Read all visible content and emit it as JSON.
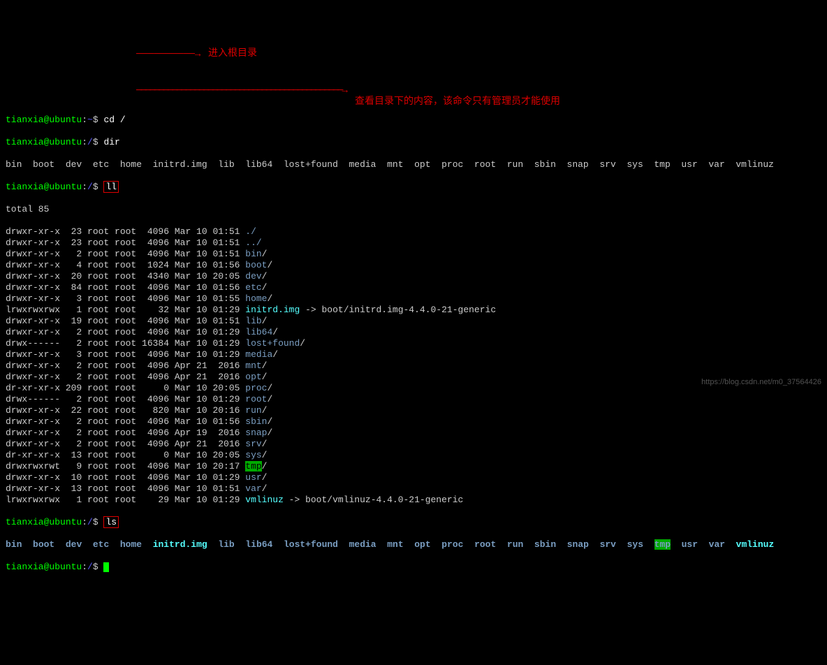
{
  "prompt": {
    "user": "tianxia@ubuntu",
    "home_path": "~",
    "root_path": "/",
    "sep": ":",
    "end": "$"
  },
  "commands": {
    "cd": "cd /",
    "dir": "dir",
    "ll": "ll",
    "ls": "ls"
  },
  "dir_output": "bin  boot  dev  etc  home  initrd.img  lib  lib64  lost+found  media  mnt  opt  proc  root  run  sbin  snap  srv  sys  tmp  usr  var  vmlinuz",
  "total_line": "total 85",
  "ll_rows": [
    {
      "perm": "drwxr-xr-x",
      "links": "23",
      "owner": "root",
      "group": "root",
      "size": "4096",
      "date": "Mar 10 01:51",
      "name": "./",
      "type": "dir"
    },
    {
      "perm": "drwxr-xr-x",
      "links": "23",
      "owner": "root",
      "group": "root",
      "size": "4096",
      "date": "Mar 10 01:51",
      "name": "../",
      "type": "dir"
    },
    {
      "perm": "drwxr-xr-x",
      "links": "2",
      "owner": "root",
      "group": "root",
      "size": "4096",
      "date": "Mar 10 01:51",
      "name": "bin",
      "suffix": "/",
      "type": "dir"
    },
    {
      "perm": "drwxr-xr-x",
      "links": "4",
      "owner": "root",
      "group": "root",
      "size": "1024",
      "date": "Mar 10 01:56",
      "name": "boot",
      "suffix": "/",
      "type": "dir"
    },
    {
      "perm": "drwxr-xr-x",
      "links": "20",
      "owner": "root",
      "group": "root",
      "size": "4340",
      "date": "Mar 10 20:05",
      "name": "dev",
      "suffix": "/",
      "type": "dir"
    },
    {
      "perm": "drwxr-xr-x",
      "links": "84",
      "owner": "root",
      "group": "root",
      "size": "4096",
      "date": "Mar 10 01:56",
      "name": "etc",
      "suffix": "/",
      "type": "dir"
    },
    {
      "perm": "drwxr-xr-x",
      "links": "3",
      "owner": "root",
      "group": "root",
      "size": "4096",
      "date": "Mar 10 01:55",
      "name": "home",
      "suffix": "/",
      "type": "dir"
    },
    {
      "perm": "lrwxrwxrwx",
      "links": "1",
      "owner": "root",
      "group": "root",
      "size": "32",
      "date": "Mar 10 01:29",
      "name": "initrd.img",
      "type": "link",
      "target": " -> boot/initrd.img-4.4.0-21-generic"
    },
    {
      "perm": "drwxr-xr-x",
      "links": "19",
      "owner": "root",
      "group": "root",
      "size": "4096",
      "date": "Mar 10 01:51",
      "name": "lib",
      "suffix": "/",
      "type": "dir"
    },
    {
      "perm": "drwxr-xr-x",
      "links": "2",
      "owner": "root",
      "group": "root",
      "size": "4096",
      "date": "Mar 10 01:29",
      "name": "lib64",
      "suffix": "/",
      "type": "dir"
    },
    {
      "perm": "drwx------",
      "links": "2",
      "owner": "root",
      "group": "root",
      "size": "16384",
      "date": "Mar 10 01:29",
      "name": "lost+found",
      "suffix": "/",
      "type": "dir"
    },
    {
      "perm": "drwxr-xr-x",
      "links": "3",
      "owner": "root",
      "group": "root",
      "size": "4096",
      "date": "Mar 10 01:29",
      "name": "media",
      "suffix": "/",
      "type": "dir"
    },
    {
      "perm": "drwxr-xr-x",
      "links": "2",
      "owner": "root",
      "group": "root",
      "size": "4096",
      "date": "Apr 21  2016",
      "name": "mnt",
      "suffix": "/",
      "type": "dir"
    },
    {
      "perm": "drwxr-xr-x",
      "links": "2",
      "owner": "root",
      "group": "root",
      "size": "4096",
      "date": "Apr 21  2016",
      "name": "opt",
      "suffix": "/",
      "type": "dir"
    },
    {
      "perm": "dr-xr-xr-x",
      "links": "209",
      "owner": "root",
      "group": "root",
      "size": "0",
      "date": "Mar 10 20:05",
      "name": "proc",
      "suffix": "/",
      "type": "dir"
    },
    {
      "perm": "drwx------",
      "links": "2",
      "owner": "root",
      "group": "root",
      "size": "4096",
      "date": "Mar 10 01:29",
      "name": "root",
      "suffix": "/",
      "type": "dir"
    },
    {
      "perm": "drwxr-xr-x",
      "links": "22",
      "owner": "root",
      "group": "root",
      "size": "820",
      "date": "Mar 10 20:16",
      "name": "run",
      "suffix": "/",
      "type": "dir"
    },
    {
      "perm": "drwxr-xr-x",
      "links": "2",
      "owner": "root",
      "group": "root",
      "size": "4096",
      "date": "Mar 10 01:56",
      "name": "sbin",
      "suffix": "/",
      "type": "dir"
    },
    {
      "perm": "drwxr-xr-x",
      "links": "2",
      "owner": "root",
      "group": "root",
      "size": "4096",
      "date": "Apr 19  2016",
      "name": "snap",
      "suffix": "/",
      "type": "dir"
    },
    {
      "perm": "drwxr-xr-x",
      "links": "2",
      "owner": "root",
      "group": "root",
      "size": "4096",
      "date": "Apr 21  2016",
      "name": "srv",
      "suffix": "/",
      "type": "dir"
    },
    {
      "perm": "dr-xr-xr-x",
      "links": "13",
      "owner": "root",
      "group": "root",
      "size": "0",
      "date": "Mar 10 20:05",
      "name": "sys",
      "suffix": "/",
      "type": "dir"
    },
    {
      "perm": "drwxrwxrwt",
      "links": "9",
      "owner": "root",
      "group": "root",
      "size": "4096",
      "date": "Mar 10 20:17",
      "name": "tmp",
      "suffix": "/",
      "type": "sticky"
    },
    {
      "perm": "drwxr-xr-x",
      "links": "10",
      "owner": "root",
      "group": "root",
      "size": "4096",
      "date": "Mar 10 01:29",
      "name": "usr",
      "suffix": "/",
      "type": "dir"
    },
    {
      "perm": "drwxr-xr-x",
      "links": "13",
      "owner": "root",
      "group": "root",
      "size": "4096",
      "date": "Mar 10 01:51",
      "name": "var",
      "suffix": "/",
      "type": "dir"
    },
    {
      "perm": "lrwxrwxrwx",
      "links": "1",
      "owner": "root",
      "group": "root",
      "size": "29",
      "date": "Mar 10 01:29",
      "name": "vmlinuz",
      "type": "link",
      "target": " -> boot/vmlinuz-4.4.0-21-generic"
    }
  ],
  "ls_items": [
    "bin",
    "boot",
    "dev",
    "etc",
    "home",
    "initrd.img",
    "lib",
    "lib64",
    "lost+found",
    "media",
    "mnt",
    "opt",
    "proc",
    "root",
    "run",
    "sbin",
    "snap",
    "srv",
    "sys",
    "tmp",
    "usr",
    "var",
    "vmlinuz"
  ],
  "annotations": {
    "ann1": "进入根目录",
    "ann2": "查看目录下的内容，该命令只有管理员才能使用"
  },
  "watermark": "https://blog.csdn.net/m0_37564426"
}
